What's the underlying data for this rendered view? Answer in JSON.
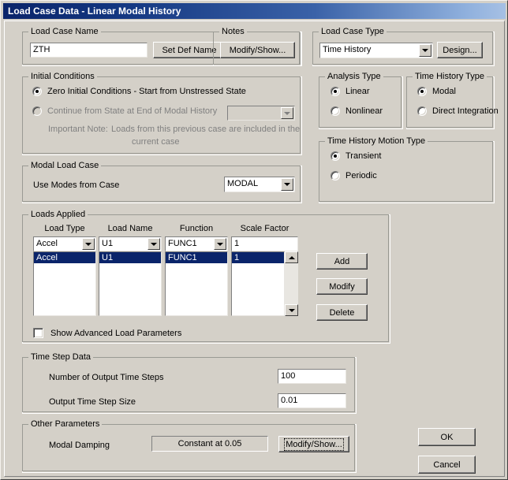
{
  "window": {
    "title": "Load Case Data - Linear Modal History",
    "titlebar_color": "#0a246a",
    "face_color": "#d4d0c8"
  },
  "load_case_name": {
    "group_label": "Load Case Name",
    "value": "ZTH",
    "set_def_name_button": "Set Def Name"
  },
  "notes": {
    "group_label": "Notes",
    "modify_show_button": "Modify/Show..."
  },
  "load_case_type": {
    "group_label": "Load Case Type",
    "selected": "Time History",
    "design_button": "Design..."
  },
  "initial_conditions": {
    "group_label": "Initial Conditions",
    "option_zero": "Zero Initial Conditions - Start from Unstressed State",
    "option_continue": "Continue from State at End of Modal History",
    "continue_case_value": "",
    "note_label": "Important Note:",
    "note_text_line1": "Loads from this previous case are included in the",
    "note_text_line2": "current case",
    "selected": "zero"
  },
  "analysis_type": {
    "group_label": "Analysis Type",
    "option_linear": "Linear",
    "option_nonlinear": "Nonlinear",
    "selected": "Linear"
  },
  "time_history_type": {
    "group_label": "Time History Type",
    "option_modal": "Modal",
    "option_direct": "Direct Integration",
    "selected": "Modal"
  },
  "time_history_motion_type": {
    "group_label": "Time History Motion Type",
    "option_transient": "Transient",
    "option_periodic": "Periodic",
    "selected": "Transient"
  },
  "modal_load_case": {
    "group_label": "Modal Load Case",
    "use_modes_label": "Use Modes from Case",
    "selected": "MODAL"
  },
  "loads_applied": {
    "group_label": "Loads Applied",
    "headers": [
      "Load Type",
      "Load Name",
      "Function",
      "Scale Factor"
    ],
    "editor_row": {
      "load_type": "Accel",
      "load_name": "U1",
      "function": "FUNC1",
      "scale_factor": "1"
    },
    "rows": [
      {
        "load_type": "Accel",
        "load_name": "U1",
        "function": "FUNC1",
        "scale_factor": "1",
        "selected": true
      }
    ],
    "buttons": {
      "add": "Add",
      "modify": "Modify",
      "delete": "Delete"
    },
    "advanced_checkbox": "Show Advanced Load Parameters",
    "advanced_checked": false
  },
  "time_step_data": {
    "group_label": "Time Step Data",
    "num_steps_label": "Number of Output Time Steps",
    "num_steps_value": "100",
    "step_size_label": "Output Time Step Size",
    "step_size_value": "0.01"
  },
  "other_parameters": {
    "group_label": "Other Parameters",
    "modal_damping_label": "Modal Damping",
    "modal_damping_value": "Constant at 0.05",
    "modify_show_button": "Modify/Show..."
  },
  "dialog_buttons": {
    "ok": "OK",
    "cancel": "Cancel"
  }
}
